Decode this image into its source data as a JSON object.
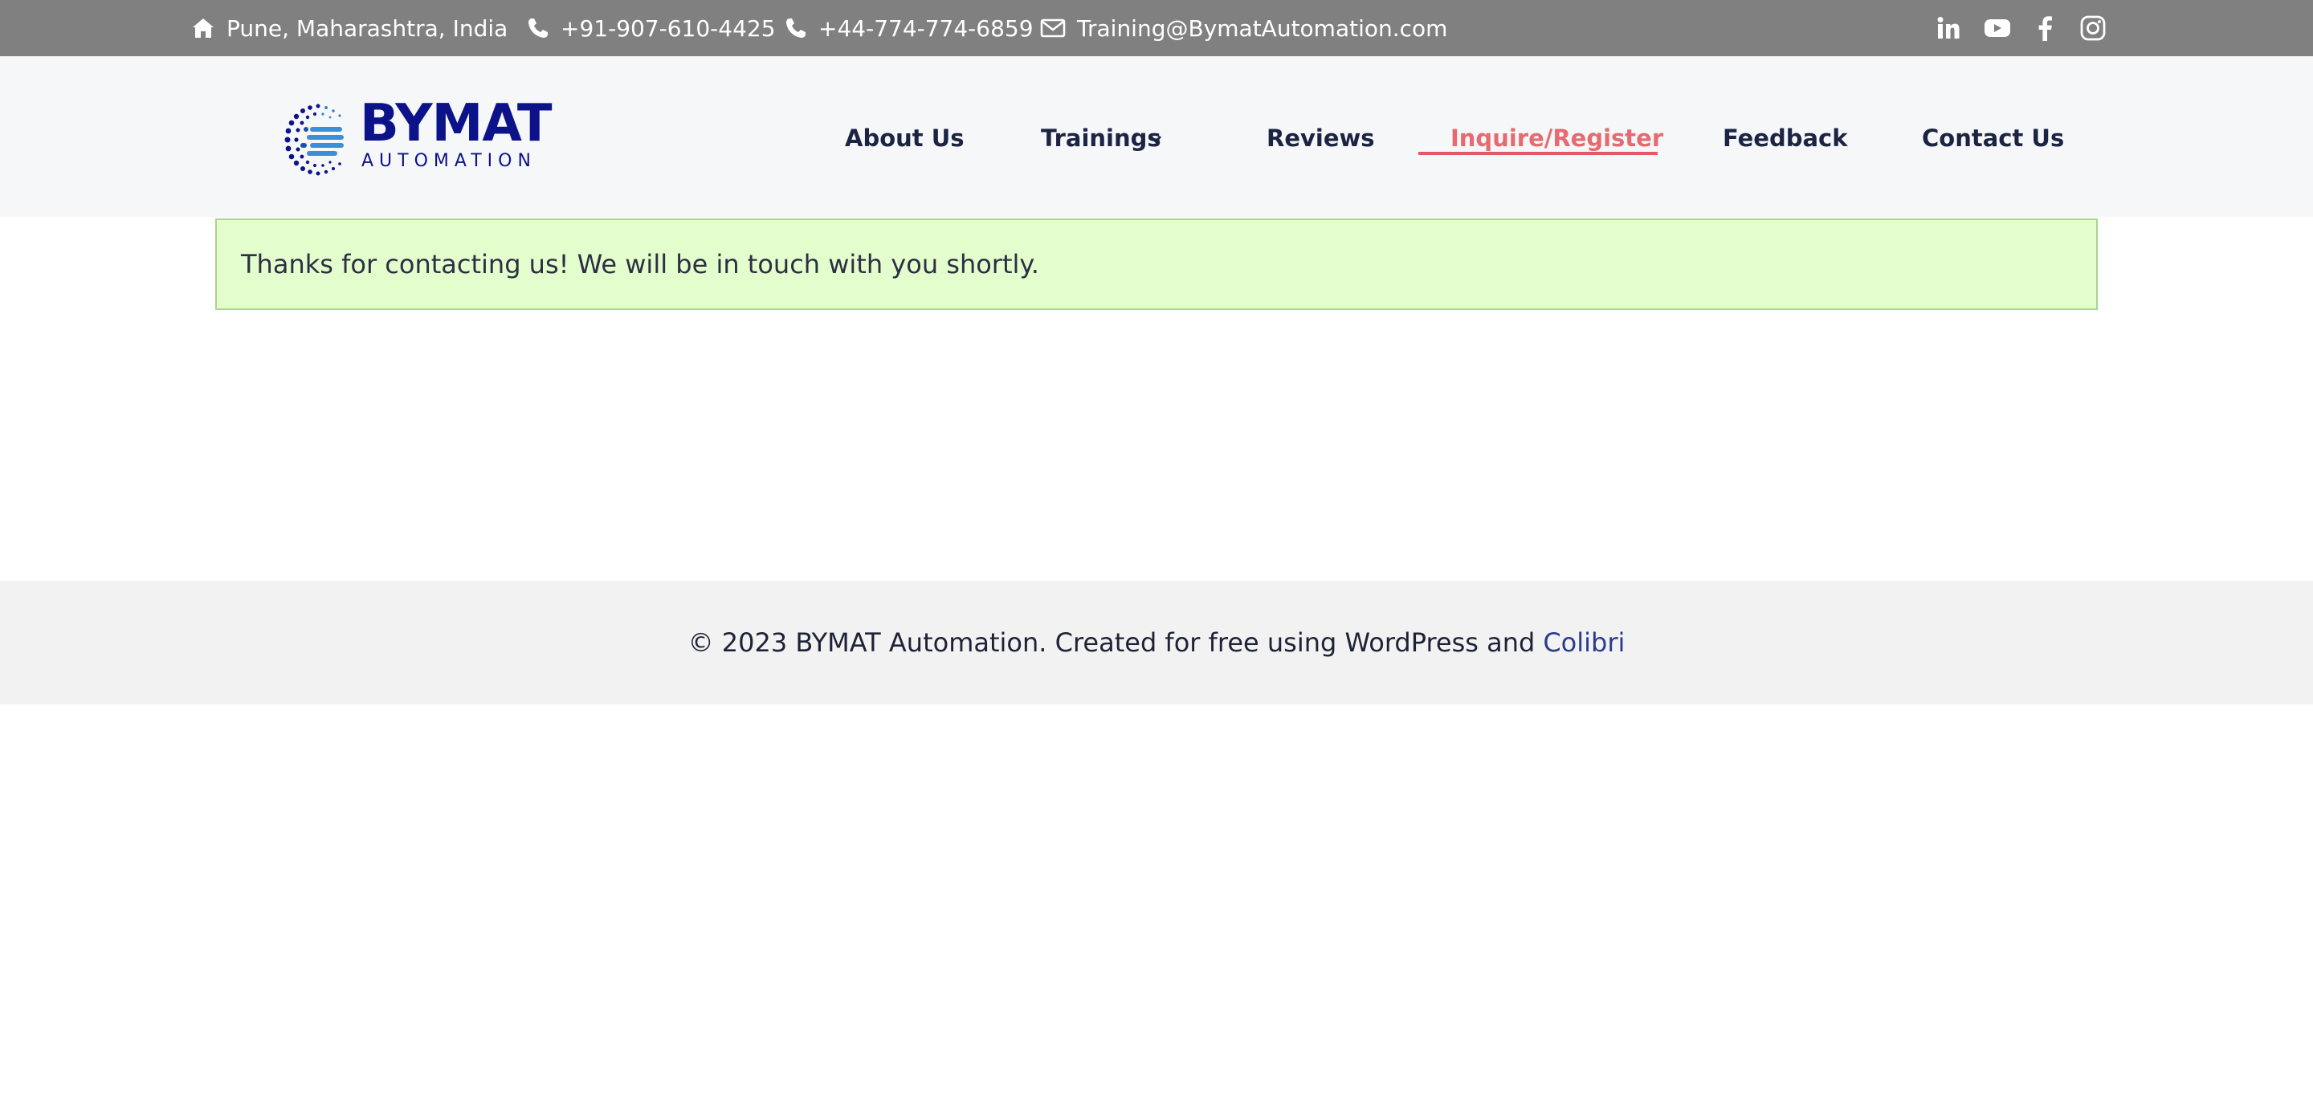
{
  "topbar": {
    "location": "Pune, Maharashtra, India",
    "phone_india": "+91-907-610-4425",
    "phone_uk": "+44-774-774-6859",
    "email": "Training@BymatAutomation.com",
    "socials": [
      "linkedin-icon",
      "youtube-icon",
      "facebook-icon",
      "instagram-icon"
    ]
  },
  "logo": {
    "word": "BYMAT",
    "sub": "AUTOMATION",
    "color": "#0c128a"
  },
  "nav": {
    "items": [
      {
        "label": "About Us"
      },
      {
        "label": "Trainings"
      },
      {
        "label": "Reviews"
      },
      {
        "label": "Inquire/Register"
      },
      {
        "label": "Feedback"
      },
      {
        "label": "Contact Us"
      }
    ],
    "active_index": 3,
    "active_color": "#e66a6f"
  },
  "notice": {
    "message": "Thanks for contacting us! We will be in touch with you shortly."
  },
  "footer": {
    "text": "© 2023 BYMAT Automation. Created for free using WordPress and",
    "link_label": "Colibri"
  },
  "colors": {
    "topbar_bg": "#808080",
    "header_bg": "#f6f7f9",
    "notice_bg": "#e4fdcd",
    "footer_bg": "#f2f2f2"
  }
}
